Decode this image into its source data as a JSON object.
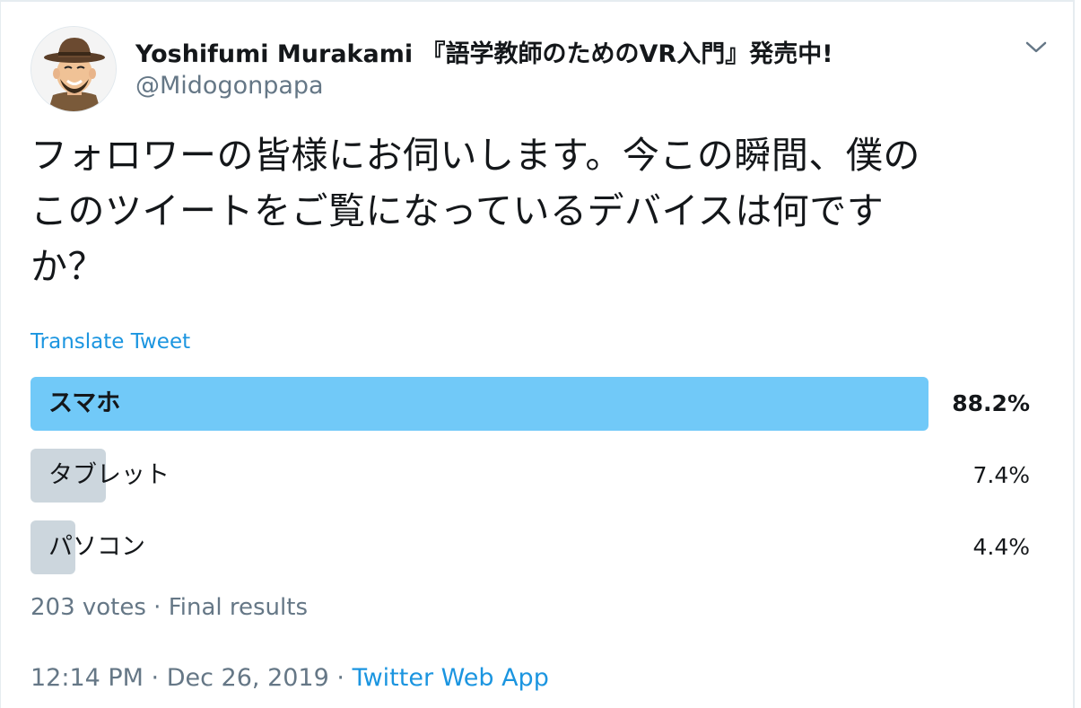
{
  "tweet": {
    "author": {
      "display_name": "Yoshifumi Murakami 『語学教師のためのVR入門』発売中!",
      "handle": "@Midogonpapa"
    },
    "text_lines": [
      "フォロワーの皆様にお伺いします。今この瞬間、僕の",
      "このツイートをご覧になっているデバイスは何です",
      "か？"
    ],
    "translate_label": "Translate Tweet",
    "poll": {
      "options": [
        {
          "label": "スマホ",
          "percent_text": "88.2%",
          "fraction": 0.882,
          "winner": true
        },
        {
          "label": "タブレット",
          "percent_text": "7.4%",
          "fraction": 0.074,
          "winner": false
        },
        {
          "label": "パソコン",
          "percent_text": "4.4%",
          "fraction": 0.044,
          "winner": false
        }
      ],
      "summary": "203 votes · Final results"
    },
    "timestamp": "12:14 PM · Dec 26, 2019",
    "separator": "·",
    "source_app": "Twitter Web App"
  },
  "colors": {
    "winner_bar": "#71c9f8",
    "other_bar": "#ccd6dd",
    "link": "#1b95e0",
    "secondary_text": "#657786"
  },
  "icons": {
    "avatar": "cartoon-man-with-hat-avatar",
    "caret": "chevron-down-icon"
  }
}
